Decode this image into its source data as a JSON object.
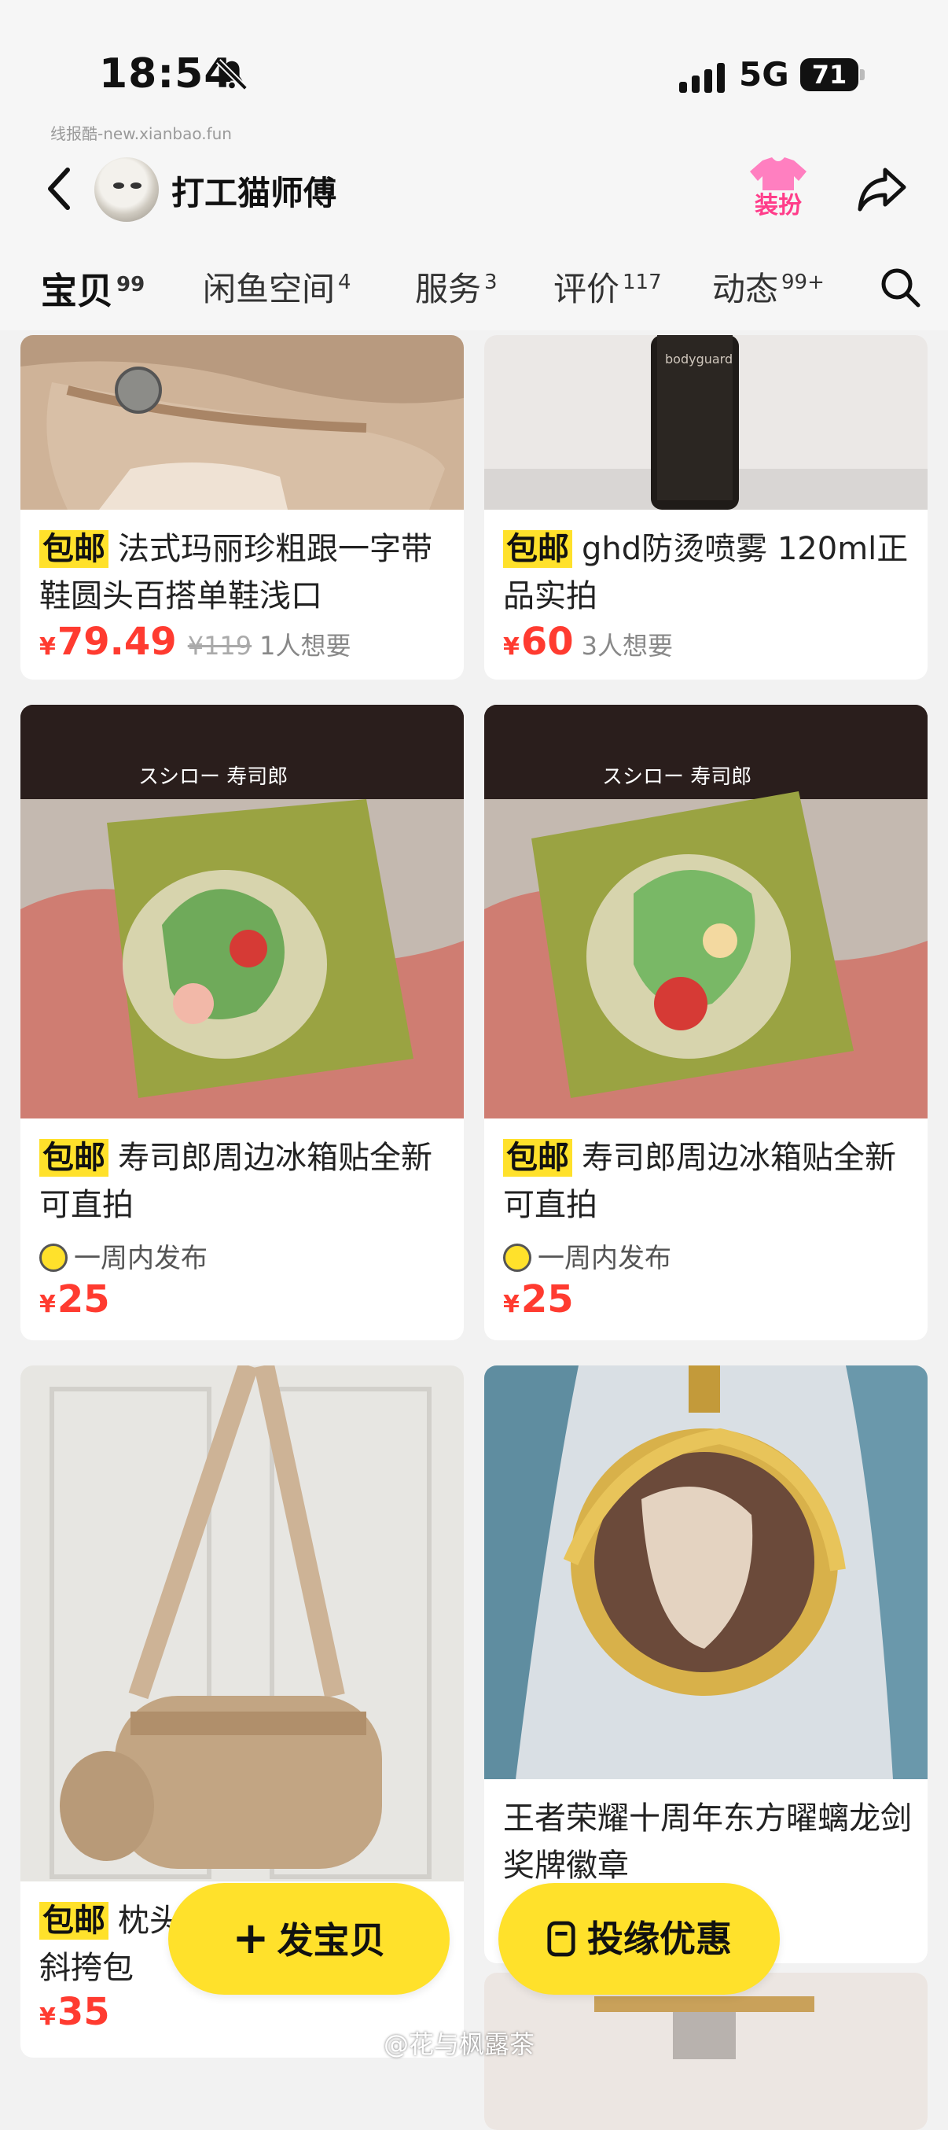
{
  "status_bar": {
    "time": "18:54",
    "network": "5G",
    "battery": "71"
  },
  "watermark_top": "线报酷-new.xianbao.fun",
  "header": {
    "shop_name": "打工猫师傅",
    "dress_label": "装扮"
  },
  "tabs": [
    {
      "label": "宝贝",
      "count": "99"
    },
    {
      "label": "闲鱼空间",
      "count": "4"
    },
    {
      "label": "服务",
      "count": "3"
    },
    {
      "label": "评价",
      "count": "117"
    },
    {
      "label": "动态",
      "count": "99+"
    }
  ],
  "products": [
    {
      "tag": "包邮",
      "title": "法式玛丽珍粗跟一字带鞋圆头百搭单鞋浅口",
      "price": "79.49",
      "original_price": "¥119",
      "want": "1人想要"
    },
    {
      "tag": "包邮",
      "title": "ghd防烫喷雾 120ml正品实拍",
      "price": "60",
      "want": "3人想要"
    },
    {
      "tag": "包邮",
      "title": "寿司郎周边冰箱贴全新可直拍",
      "posted": "一周内发布",
      "price": "25"
    },
    {
      "tag": "包邮",
      "title": "寿司郎周边冰箱贴全新可直拍",
      "posted": "一周内发布",
      "price": "25"
    },
    {
      "tag": "包邮",
      "title": "枕头",
      "title_line2": "斜挎包",
      "price": "35"
    },
    {
      "title": "王者荣耀十周年东方曜螭龙剑奖牌徽章"
    }
  ],
  "currency": "¥",
  "buttons": {
    "publish": "发宝贝",
    "promote": "投缘优惠"
  },
  "watermark_bottom": "@花与枫露茶",
  "image_texts": {
    "sushiro": "スシロー 寿司郎",
    "bottle": "bodyguard"
  }
}
